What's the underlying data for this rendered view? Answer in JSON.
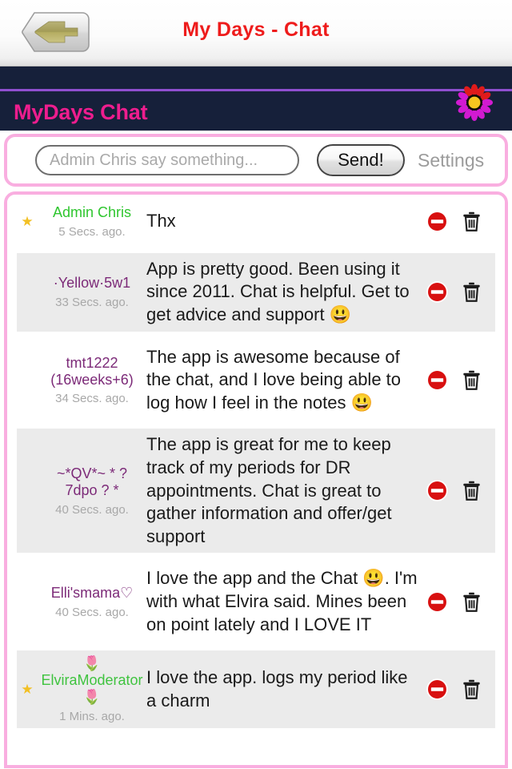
{
  "navbar": {
    "title": "My Days - Chat",
    "back_label": "Back"
  },
  "brandbar": {
    "title": "MyDays Chat",
    "logo": "flower-logo"
  },
  "compose": {
    "placeholder": "Admin Chris say something...",
    "value": "",
    "send_label": "Send!",
    "settings_label": "Settings"
  },
  "colors": {
    "nav_title": "#ee1c1c",
    "brand_bg": "#16203a",
    "brand_title": "#ee1d8e",
    "brand_rule": "#8f4fcf",
    "pink_border": "#f9aee0",
    "alt_row": "#ebebeb",
    "username": "#7c2a78",
    "admin_name": "#2fc62f",
    "timestamp": "#a8a8a8",
    "block_icon": "#d81010",
    "star": "#f2c024"
  },
  "actions": {
    "block_label": "block-icon",
    "delete_label": "trash-icon"
  },
  "messages": [
    {
      "star": "★",
      "username": "Admin Chris",
      "name_class": "admin",
      "ago": "5 Secs. ago.",
      "text": "Thx",
      "alt": false
    },
    {
      "star": "",
      "username": "·Yellow·5w1",
      "name_class": "",
      "ago": "33 Secs. ago.",
      "text": "App is pretty good. Been using it since 2011. Chat is helpful. Get to get advice and support 😃",
      "alt": true
    },
    {
      "star": "",
      "username": "tmt1222 (16weeks+6)",
      "name_class": "",
      "ago": "34 Secs. ago.",
      "text": "The app is awesome because of the chat, and I love being able to log how I feel in the notes 😃",
      "alt": false
    },
    {
      "star": "",
      "username": "~*QV*~ * ? 7dpo ? *",
      "name_class": "",
      "ago": "40 Secs. ago.",
      "text": "The app is great for me to keep track of my periods for DR appointments. Chat is great to gather information and offer/get support",
      "alt": true
    },
    {
      "star": "",
      "username": "Elli'smama♡",
      "name_class": "",
      "ago": "40 Secs. ago.",
      "text": "I love the app and the Chat 😃. I'm with what Elvira said. Mines been on point lately and I LOVE IT",
      "alt": false
    },
    {
      "star": "★",
      "username": "🌷 ElviraModerator 🌷",
      "name_class": "modr",
      "ago": "1 Mins. ago.",
      "text": "I love the app. logs my period like a charm",
      "alt": true
    }
  ]
}
